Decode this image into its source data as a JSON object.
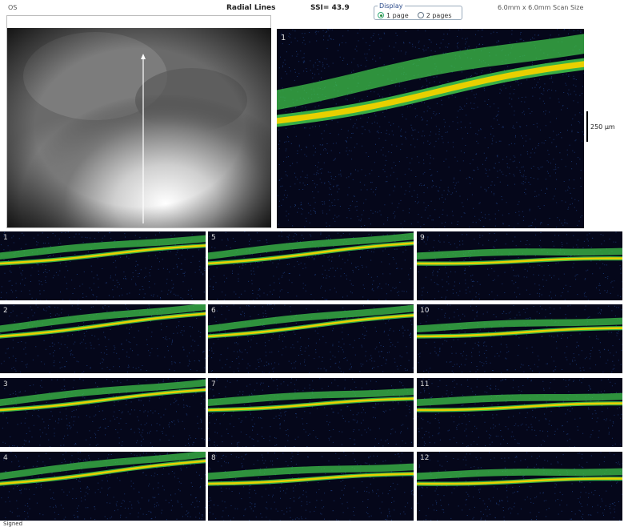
{
  "header": {
    "eye": "OS",
    "scan_pattern": "Radial Lines",
    "ssi": "SSI= 43.9",
    "scan_size": "6.0mm x 6.0mm Scan Size"
  },
  "display": {
    "legend": "Display",
    "options": [
      {
        "label": "1 page",
        "selected": true
      },
      {
        "label": "2 pages",
        "selected": false
      }
    ]
  },
  "large_scan": {
    "label": "1"
  },
  "scale": {
    "label": "250 μm"
  },
  "thumbnails": [
    {
      "label": "1"
    },
    {
      "label": "5"
    },
    {
      "label": "9"
    },
    {
      "label": "2"
    },
    {
      "label": "6"
    },
    {
      "label": "10"
    },
    {
      "label": "3"
    },
    {
      "label": "7"
    },
    {
      "label": "11"
    },
    {
      "label": "4"
    },
    {
      "label": "8"
    },
    {
      "label": "12"
    }
  ],
  "footer": {
    "text": "Signed"
  },
  "colors": {
    "background": "#05071a",
    "rpe_band": "#e8d000",
    "retina_layer": "#3ec24a",
    "noise": "#2a5ab0"
  }
}
